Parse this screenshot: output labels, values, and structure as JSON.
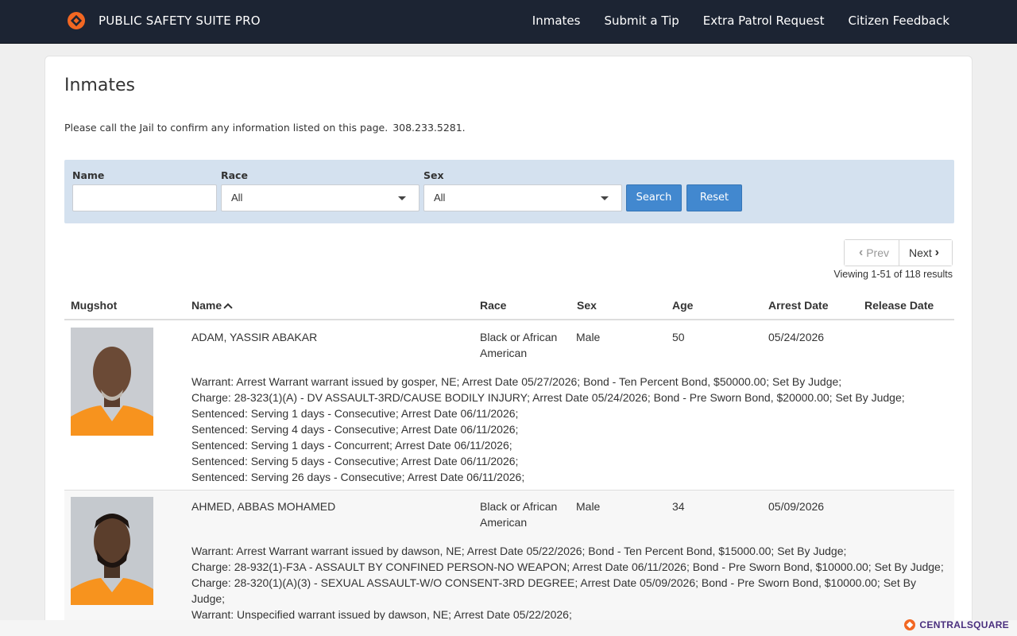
{
  "navbar": {
    "brand": "PUBLIC SAFETY SUITE PRO",
    "links": [
      "Inmates",
      "Submit a Tip",
      "Extra Patrol Request",
      "Citizen Feedback"
    ]
  },
  "page": {
    "title": "Inmates",
    "notice": "Please call the Jail to confirm any information listed on this page.",
    "phone": "308.233.5281."
  },
  "filter": {
    "name_label": "Name",
    "name_value": "",
    "race_label": "Race",
    "race_value": "All",
    "sex_label": "Sex",
    "sex_value": "All",
    "search_label": "Search",
    "reset_label": "Reset"
  },
  "pager": {
    "prev": "Prev",
    "next": "Next",
    "viewing": "Viewing 1-51 of 118 results"
  },
  "table": {
    "columns": [
      "Mugshot",
      "Name",
      "Race",
      "Sex",
      "Age",
      "Arrest Date",
      "Release Date"
    ],
    "rows": [
      {
        "name": "ADAM, YASSIR ABAKAR",
        "race": "Black or African American",
        "sex": "Male",
        "age": "50",
        "arrest_date": "05/24/2026",
        "release_date": "",
        "charges": [
          "Warrant: Arrest Warrant warrant issued by gosper, NE; Arrest Date 05/27/2026; Bond - Ten Percent Bond, $50000.00; Set By Judge;",
          "Charge: 28-323(1)(A) - DV ASSAULT-3RD/CAUSE BODILY INJURY; Arrest Date 05/24/2026; Bond - Pre Sworn Bond, $20000.00; Set By Judge;",
          "Sentenced: Serving 1 days - Consecutive; Arrest Date 06/11/2026;",
          "Sentenced: Serving 4 days - Consecutive; Arrest Date 06/11/2026;",
          "Sentenced: Serving 1 days - Concurrent; Arrest Date 06/11/2026;",
          "Sentenced: Serving 5 days - Consecutive; Arrest Date 06/11/2026;",
          "Sentenced: Serving 26 days - Consecutive; Arrest Date 06/11/2026;"
        ]
      },
      {
        "name": "AHMED, ABBAS MOHAMED",
        "race": "Black or African American",
        "sex": "Male",
        "age": "34",
        "arrest_date": "05/09/2026",
        "release_date": "",
        "charges": [
          "Warrant: Arrest Warrant warrant issued by dawson, NE; Arrest Date 05/22/2026; Bond - Ten Percent Bond, $15000.00; Set By Judge;",
          "Charge: 28-932(1)-F3A - ASSAULT BY CONFINED PERSON-NO WEAPON; Arrest Date 06/11/2026; Bond - Pre Sworn Bond, $10000.00; Set By Judge;",
          "Charge: 28-320(1)(A)(3) - SEXUAL ASSAULT-W/O CONSENT-3RD DEGREE; Arrest Date 05/09/2026; Bond - Pre Sworn Bond, $10000.00; Set By Judge;",
          "Warrant: Unspecified warrant issued by dawson, NE; Arrest Date 05/22/2026;"
        ]
      }
    ]
  },
  "footer": {
    "vendor_logo": "CENTRALSQUARE"
  },
  "colors": {
    "navbar": "#1c2433",
    "brand_accent": "#f26722",
    "button": "#4288cf",
    "filter_panel": "#d4e1ef",
    "inmate_uniform": "#f7931e"
  }
}
